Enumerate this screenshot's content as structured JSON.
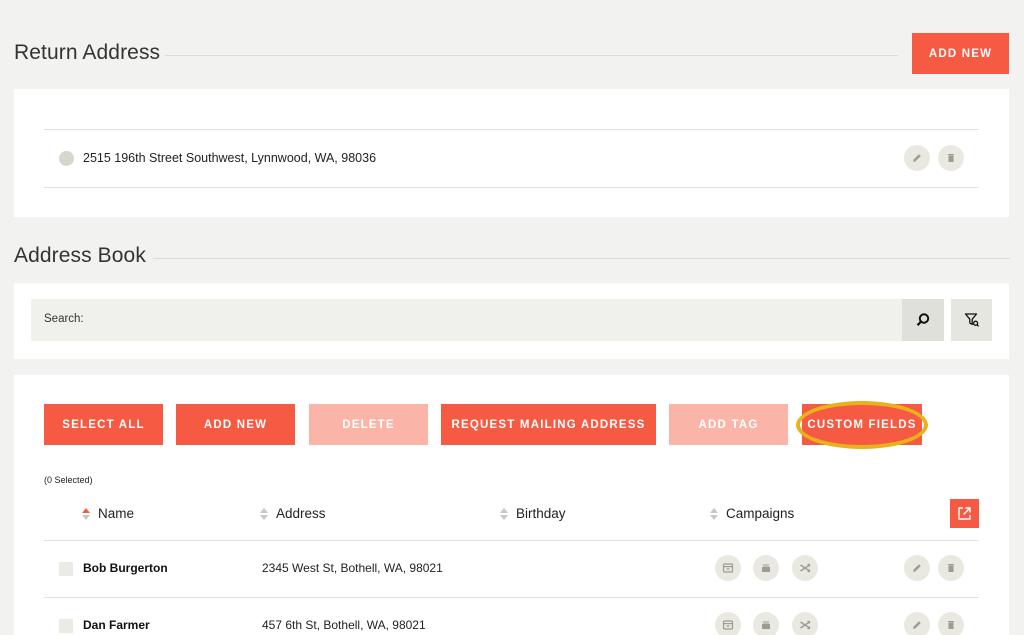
{
  "return_address": {
    "title": "Return Address",
    "add_new_label": "ADD NEW",
    "items": [
      {
        "address": "2515 196th Street Southwest, Lynnwood, WA, 98036"
      }
    ]
  },
  "address_book": {
    "title": "Address Book",
    "search_label": "Search:",
    "buttons": {
      "select_all": "SELECT ALL",
      "add_new": "ADD NEW",
      "delete": "DELETE",
      "request_mailing_address": "REQUEST MAILING ADDRESS",
      "add_tag": "ADD TAG",
      "custom_fields": "CUSTOM FIELDS"
    },
    "selected_count": "(0 Selected)",
    "columns": {
      "name": "Name",
      "address": "Address",
      "birthday": "Birthday",
      "campaigns": "Campaigns"
    },
    "rows": [
      {
        "name": "Bob Burgerton",
        "address": "2345 West St, Bothell, WA, 98021",
        "birthday": ""
      },
      {
        "name": "Dan Farmer",
        "address": "457 6th St, Bothell, WA, 98021",
        "birthday": ""
      }
    ]
  },
  "colors": {
    "accent": "#f65a42",
    "accent_disabled": "#fbb4a8",
    "highlight": "#e8b21a"
  },
  "icons": {
    "edit": "pencil-icon",
    "delete": "trash-icon",
    "search": "search-icon",
    "filter": "filter-icon",
    "export": "export-icon",
    "campaign_1": "archive-box-icon",
    "campaign_2": "cake-icon",
    "campaign_3": "shuffle-icon"
  }
}
